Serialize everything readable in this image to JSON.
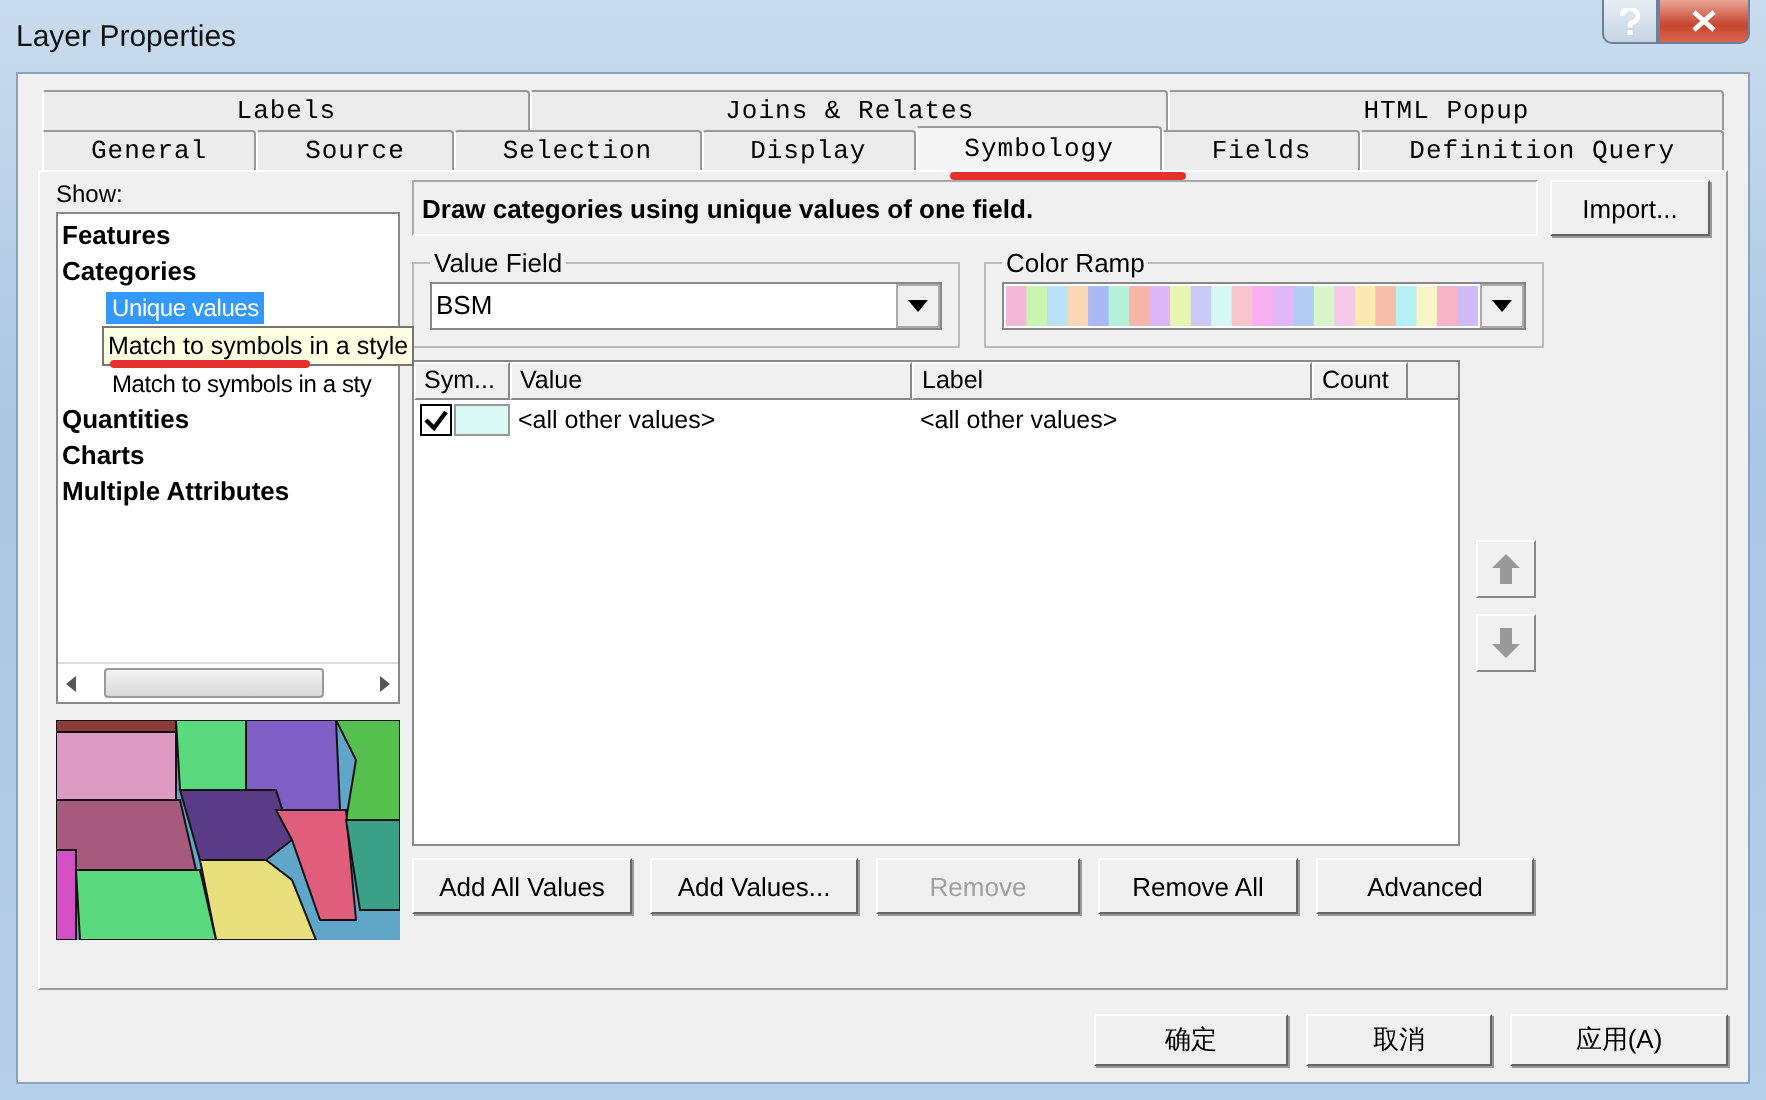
{
  "window": {
    "title": "Layer Properties"
  },
  "tab_rows": [
    [
      {
        "label": "Labels",
        "selected": false
      },
      {
        "label": "Joins & Relates",
        "selected": false
      },
      {
        "label": "HTML Popup",
        "selected": false
      }
    ],
    [
      {
        "label": "General",
        "selected": false
      },
      {
        "label": "Source",
        "selected": false
      },
      {
        "label": "Selection",
        "selected": false
      },
      {
        "label": "Display",
        "selected": false
      },
      {
        "label": "Symbology",
        "selected": true
      },
      {
        "label": "Fields",
        "selected": false
      },
      {
        "label": "Definition Query",
        "selected": false
      }
    ]
  ],
  "show": {
    "label": "Show:",
    "tree": [
      {
        "label": "Features",
        "selected": false
      },
      {
        "label": "Categories",
        "selected": false,
        "children": [
          {
            "label": "Unique values",
            "selected": true,
            "tooltip": false
          },
          {
            "label": "Match to symbols in a style",
            "selected": false,
            "tooltip": true
          },
          {
            "label": "Match to symbols in a sty",
            "selected": false,
            "tooltip": false
          }
        ]
      },
      {
        "label": "Quantities",
        "selected": false
      },
      {
        "label": "Charts",
        "selected": false
      },
      {
        "label": "Multiple Attributes",
        "selected": false
      }
    ]
  },
  "description": "Draw categories using unique values of one field.",
  "import_button": "Import...",
  "value_field": {
    "label": "Value Field",
    "value": "BSM"
  },
  "color_ramp": {
    "label": "Color Ramp"
  },
  "table": {
    "columns": [
      "Sym...",
      "Value",
      "Label",
      "Count"
    ],
    "rows": [
      {
        "checked": true,
        "color": "#d8f8f4",
        "value": "<all other values>",
        "label": "<all other values>"
      }
    ]
  },
  "buttons": [
    {
      "label": "Add All Values",
      "disabled": false
    },
    {
      "label": "Add Values...",
      "disabled": false
    },
    {
      "label": "Remove",
      "disabled": true
    },
    {
      "label": "Remove All",
      "disabled": false
    },
    {
      "label": "Advanced",
      "disabled": false
    }
  ],
  "dialog_buttons": [
    "确定",
    "取消",
    "应用(A)"
  ]
}
